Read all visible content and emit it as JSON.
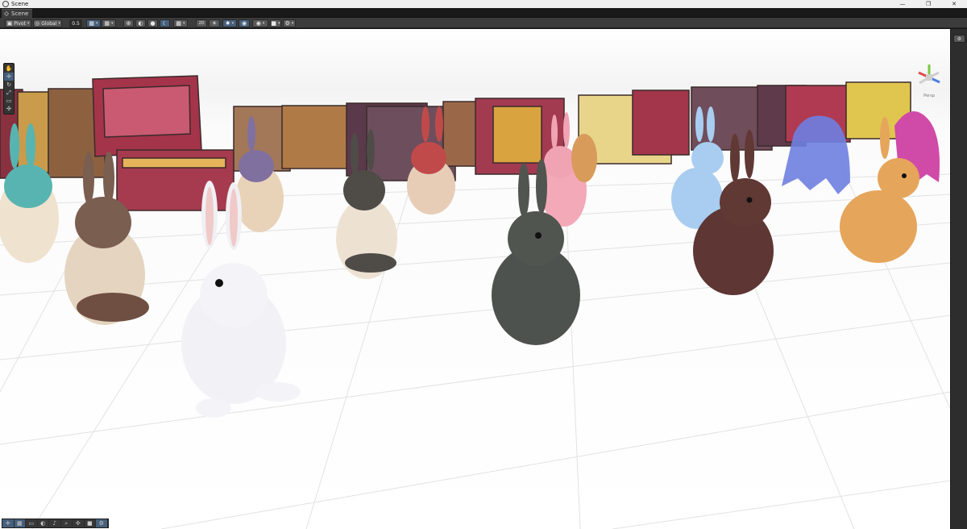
{
  "window": {
    "title": "Scene",
    "minimize": "—",
    "maximize": "❐",
    "close": "✕"
  },
  "tab": {
    "label": "Scene"
  },
  "toolbar": {
    "pivot": "Pivot",
    "global": "Global",
    "snap_value": "0.5"
  },
  "gizmo": {
    "projection": "Persp"
  },
  "icons": {
    "hand": "✋",
    "move": "✛",
    "rotate": "↻",
    "scale": "⤢",
    "rect": "▭",
    "transform": "✣",
    "grid": "▦",
    "dropdown": "▾",
    "circle": "●",
    "half": "◐",
    "moon": "☾",
    "eye": "◉",
    "camera": "■",
    "gear": "⚙",
    "search": "⌕",
    "light": "☀",
    "audio": "♪"
  },
  "colors": {
    "selected": "#46607c",
    "toolbar": "#3c3c3c",
    "grid_line": "#e4e4e4",
    "floor": "#ffffff"
  }
}
